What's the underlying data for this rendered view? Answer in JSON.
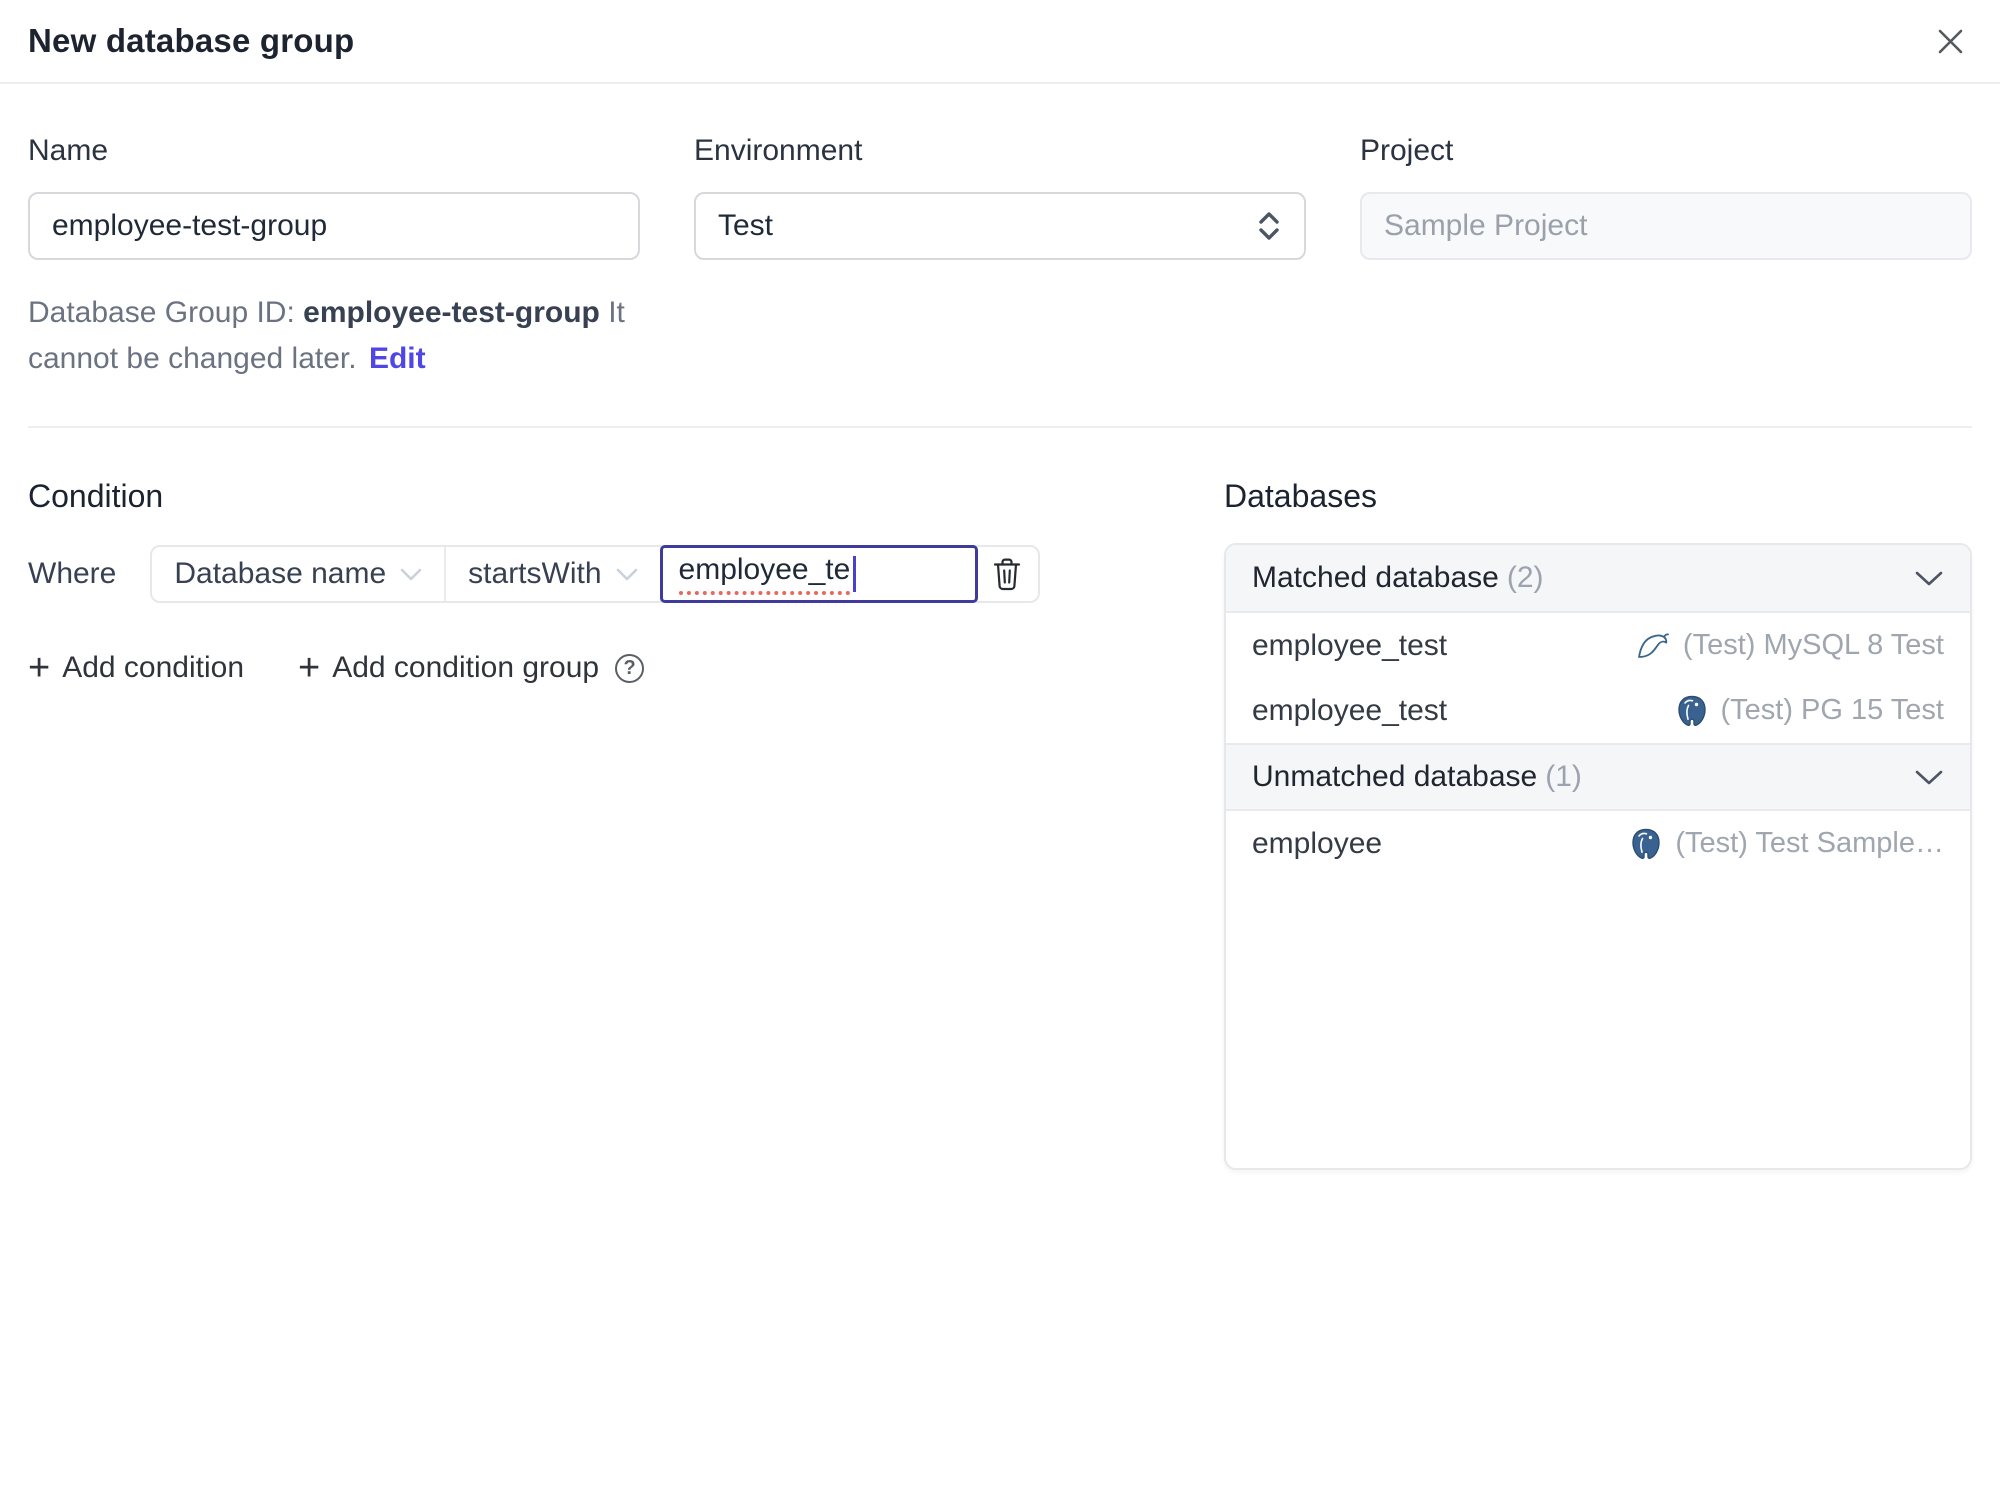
{
  "dialog": {
    "title": "New database group"
  },
  "form": {
    "name": {
      "label": "Name",
      "value": "employee-test-group"
    },
    "environment": {
      "label": "Environment",
      "value": "Test"
    },
    "project": {
      "label": "Project",
      "value": "Sample Project"
    },
    "group_id_helper": {
      "prefix": "Database Group ID: ",
      "id": "employee-test-group",
      "suffix": " It cannot be changed later.",
      "edit_label": "Edit"
    }
  },
  "condition": {
    "heading": "Condition",
    "where_label": "Where",
    "field_selector": "Database name",
    "operator_selector": "startsWith",
    "value_input": "employee_te",
    "add_condition_label": "Add condition",
    "add_condition_group_label": "Add condition group",
    "help_glyph": "?"
  },
  "databases": {
    "heading": "Databases",
    "matched": {
      "title": "Matched database",
      "count": "(2)",
      "rows": [
        {
          "name": "employee_test",
          "engine": "mysql",
          "instance": "(Test) MySQL 8 Test"
        },
        {
          "name": "employee_test",
          "engine": "postgres",
          "instance": "(Test) PG 15 Test"
        }
      ]
    },
    "unmatched": {
      "title": "Unmatched database",
      "count": "(1)",
      "rows": [
        {
          "name": "employee",
          "engine": "postgres",
          "instance": "(Test) Test Sample…"
        }
      ]
    }
  },
  "icons": {
    "close": "close-icon",
    "select_updown": "select-updown-icon",
    "chevron_down": "chevron-down-icon",
    "trash": "trash-icon",
    "help": "help-icon",
    "mysql": "mysql-icon",
    "postgres": "postgres-icon"
  },
  "colors": {
    "accent": "#4f46e5",
    "focus_border": "#3e3b9d",
    "spellcheck_underline": "#e8695c",
    "mysql_icon": "#39658b",
    "postgres_icon": "#3a6290",
    "panel_header_bg": "#f5f6f8",
    "border": "#e6e8eb"
  }
}
